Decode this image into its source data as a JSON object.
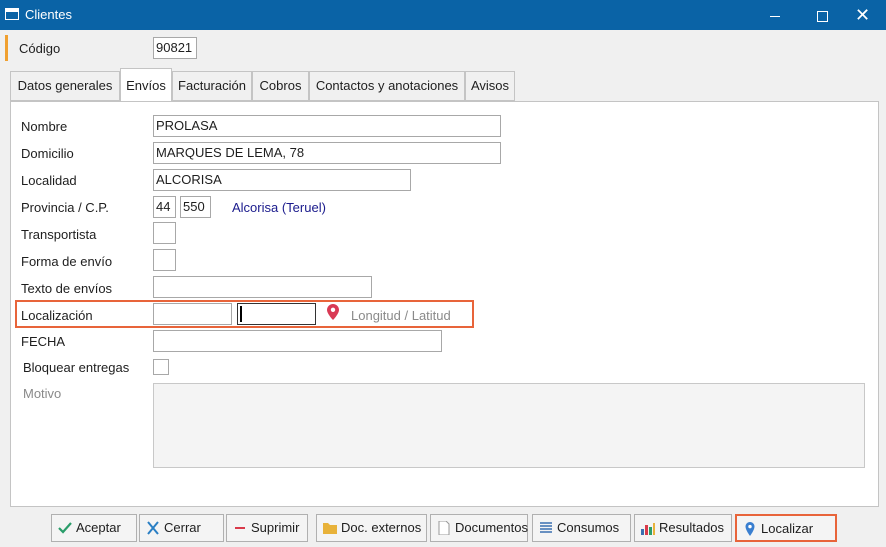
{
  "window": {
    "title": "Clientes",
    "min_label": "",
    "max_label": "",
    "close_label": "✕"
  },
  "codigo": {
    "label": "Código",
    "value": "90821"
  },
  "tabs": [
    {
      "label": "Datos generales"
    },
    {
      "label": "Envíos"
    },
    {
      "label": "Facturación"
    },
    {
      "label": "Cobros"
    },
    {
      "label": "Contactos y anotaciones"
    },
    {
      "label": "Avisos"
    }
  ],
  "form": {
    "nombre": {
      "label": "Nombre",
      "value": "PROLASA"
    },
    "domicilio": {
      "label": "Domicilio",
      "value": "MARQUES DE LEMA, 78"
    },
    "localidad": {
      "label": "Localidad",
      "value": "ALCORISA"
    },
    "provincia": {
      "label": "Provincia / C.P.",
      "province_code": "44",
      "postal_code": "550",
      "resolved": "Alcorisa (Teruel)"
    },
    "transportista": {
      "label": "Transportista",
      "value": ""
    },
    "forma_envio": {
      "label": "Forma de envío",
      "value": ""
    },
    "texto_envios": {
      "label": "Texto de envíos",
      "value": ""
    },
    "localizacion": {
      "label": "Localización",
      "longitude": "",
      "latitude": "",
      "hint": "Longitud / Latitud"
    },
    "fecha": {
      "label": "FECHA",
      "value": ""
    },
    "bloquear": {
      "label": "Bloquear entregas",
      "checked": false
    },
    "motivo": {
      "label": "Motivo",
      "value": ""
    }
  },
  "buttons": [
    {
      "label": "Aceptar"
    },
    {
      "label": "Cerrar"
    },
    {
      "label": "Suprimir"
    },
    {
      "label": "Doc. externos"
    },
    {
      "label": "Documentos"
    },
    {
      "label": "Consumos"
    },
    {
      "label": "Resultados"
    },
    {
      "label": "Localizar"
    }
  ],
  "colors": {
    "titlebar": "#0a63a6",
    "highlight": "#e8643a",
    "accent_bar": "#f0a030",
    "resolved_text": "#1a1a8c"
  }
}
